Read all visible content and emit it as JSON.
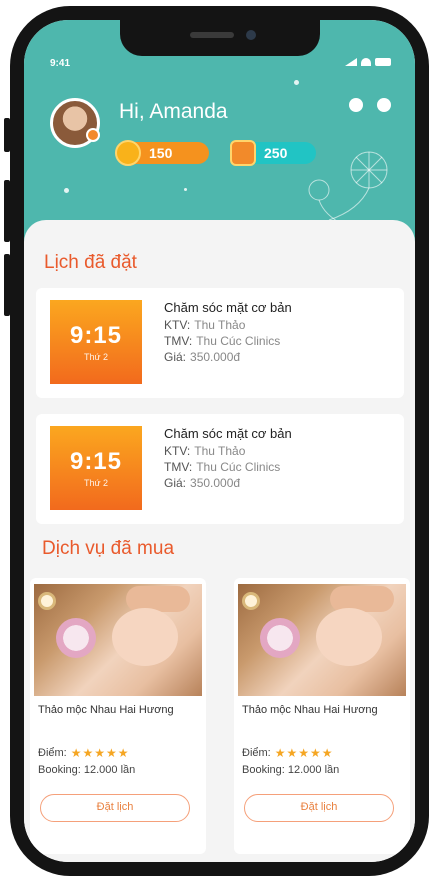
{
  "status_bar": {
    "time": "9:41"
  },
  "header": {
    "greeting": "Hi, Amanda",
    "coins": "150",
    "gifts": "250"
  },
  "booked": {
    "title": "Lịch đã đặt",
    "items": [
      {
        "time": "9:15",
        "date": "Thứ 2",
        "service": "Chăm sóc mặt cơ bản",
        "ktv_label": "KTV:",
        "ktv_value": "Thu Thảo",
        "tmv_label": "TMV:",
        "tmv_value": "Thu Cúc Clinics",
        "price_label": "Giá:",
        "price_value": "350.000đ"
      },
      {
        "time": "9:15",
        "date": "Thứ 2",
        "service": "Chăm sóc mặt cơ bản",
        "ktv_label": "KTV:",
        "ktv_value": "Thu Thảo",
        "tmv_label": "TMV:",
        "tmv_value": "Thu Cúc Clinics",
        "price_label": "Giá:",
        "price_value": "350.000đ"
      }
    ]
  },
  "bought": {
    "title": "Dịch vụ đã mua",
    "items": [
      {
        "name": "Thảo mộc Nhau Hai Hương",
        "rating_label": "Điểm:",
        "stars": "★★★★★",
        "sold": "Booking: 12.000 lần",
        "button": "Đặt lịch"
      },
      {
        "name": "Thảo mộc Nhau Hai Hương",
        "rating_label": "Điểm:",
        "stars": "★★★★★",
        "sold": "Booking: 12.000 lần",
        "button": "Đặt lịch"
      }
    ]
  },
  "colors": {
    "header_bg": "#4eb7ad",
    "accent_orange": "#e95a2c",
    "coin_pill": "#f5921e",
    "gift_pill": "#21c4c4"
  }
}
